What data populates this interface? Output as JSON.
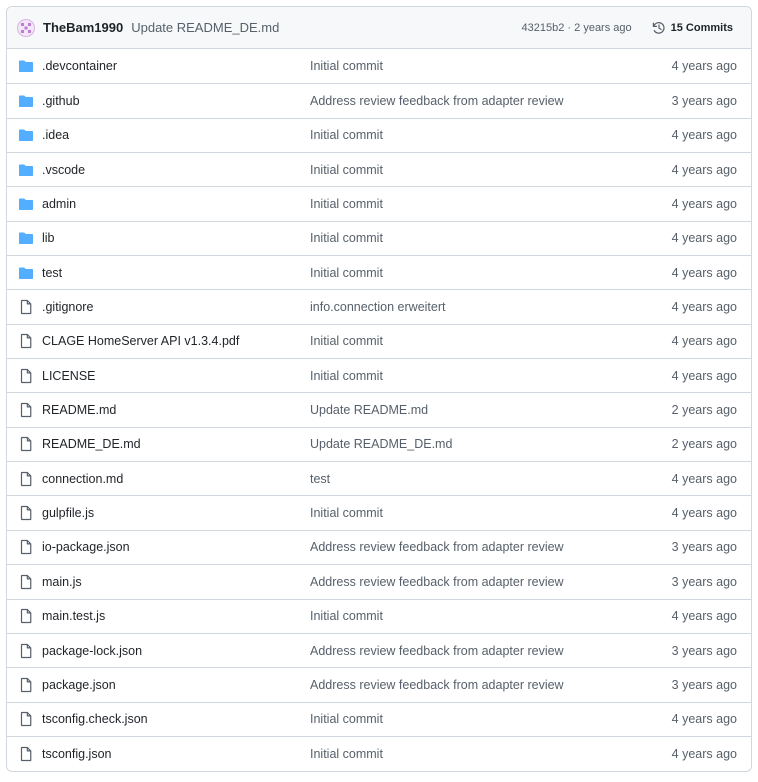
{
  "header": {
    "author": "TheBam1990",
    "message": "Update README_DE.md",
    "meta": "43215b2 · 2 years ago",
    "commits_label": "15 Commits"
  },
  "colors": {
    "folder": "#54aeff",
    "file": "#57606a",
    "avatar": "#bf7fcf"
  },
  "files": [
    {
      "name": ".devcontainer",
      "type": "folder",
      "message": "Initial commit",
      "date": "4 years ago"
    },
    {
      "name": ".github",
      "type": "folder",
      "message": "Address review feedback from adapter review",
      "date": "3 years ago"
    },
    {
      "name": ".idea",
      "type": "folder",
      "message": "Initial commit",
      "date": "4 years ago"
    },
    {
      "name": ".vscode",
      "type": "folder",
      "message": "Initial commit",
      "date": "4 years ago"
    },
    {
      "name": "admin",
      "type": "folder",
      "message": "Initial commit",
      "date": "4 years ago"
    },
    {
      "name": "lib",
      "type": "folder",
      "message": "Initial commit",
      "date": "4 years ago"
    },
    {
      "name": "test",
      "type": "folder",
      "message": "Initial commit",
      "date": "4 years ago"
    },
    {
      "name": ".gitignore",
      "type": "file",
      "message": "info.connection erweitert",
      "date": "4 years ago"
    },
    {
      "name": "CLAGE HomeServer API v1.3.4.pdf",
      "type": "file",
      "message": "Initial commit",
      "date": "4 years ago"
    },
    {
      "name": "LICENSE",
      "type": "file",
      "message": "Initial commit",
      "date": "4 years ago"
    },
    {
      "name": "README.md",
      "type": "file",
      "message": "Update README.md",
      "date": "2 years ago"
    },
    {
      "name": "README_DE.md",
      "type": "file",
      "message": "Update README_DE.md",
      "date": "2 years ago"
    },
    {
      "name": "connection.md",
      "type": "file",
      "message": "test",
      "date": "4 years ago"
    },
    {
      "name": "gulpfile.js",
      "type": "file",
      "message": "Initial commit",
      "date": "4 years ago"
    },
    {
      "name": "io-package.json",
      "type": "file",
      "message": "Address review feedback from adapter review",
      "date": "3 years ago"
    },
    {
      "name": "main.js",
      "type": "file",
      "message": "Address review feedback from adapter review",
      "date": "3 years ago"
    },
    {
      "name": "main.test.js",
      "type": "file",
      "message": "Initial commit",
      "date": "4 years ago"
    },
    {
      "name": "package-lock.json",
      "type": "file",
      "message": "Address review feedback from adapter review",
      "date": "3 years ago"
    },
    {
      "name": "package.json",
      "type": "file",
      "message": "Address review feedback from adapter review",
      "date": "3 years ago"
    },
    {
      "name": "tsconfig.check.json",
      "type": "file",
      "message": "Initial commit",
      "date": "4 years ago"
    },
    {
      "name": "tsconfig.json",
      "type": "file",
      "message": "Initial commit",
      "date": "4 years ago"
    }
  ]
}
